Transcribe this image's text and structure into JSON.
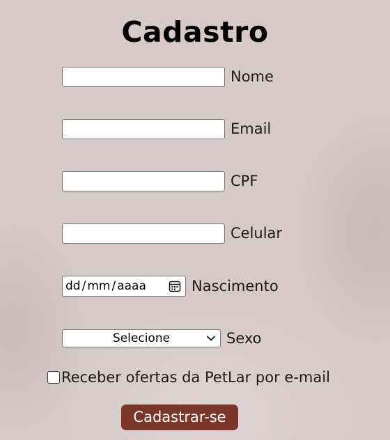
{
  "title": "Cadastro",
  "fields": {
    "nome": {
      "label": "Nome",
      "value": ""
    },
    "email": {
      "label": "Email",
      "value": ""
    },
    "cpf": {
      "label": "CPF",
      "value": ""
    },
    "celular": {
      "label": "Celular",
      "value": ""
    },
    "nascimento": {
      "label": "Nascimento",
      "placeholder": {
        "day": "dd",
        "month": "mm",
        "year": "aaaa",
        "separator": "/"
      },
      "icon": "calendar-icon"
    },
    "sexo": {
      "label": "Sexo",
      "selected": "Selecione",
      "icon": "chevron-down-icon"
    }
  },
  "newsletter": {
    "label": "Receber ofertas da PetLar por e-mail",
    "checked": false
  },
  "submit": {
    "label": "Cadastrar-se"
  },
  "colors": {
    "background": "#d5c9c9",
    "button": "#7a3628",
    "button_text": "#ffffff"
  }
}
